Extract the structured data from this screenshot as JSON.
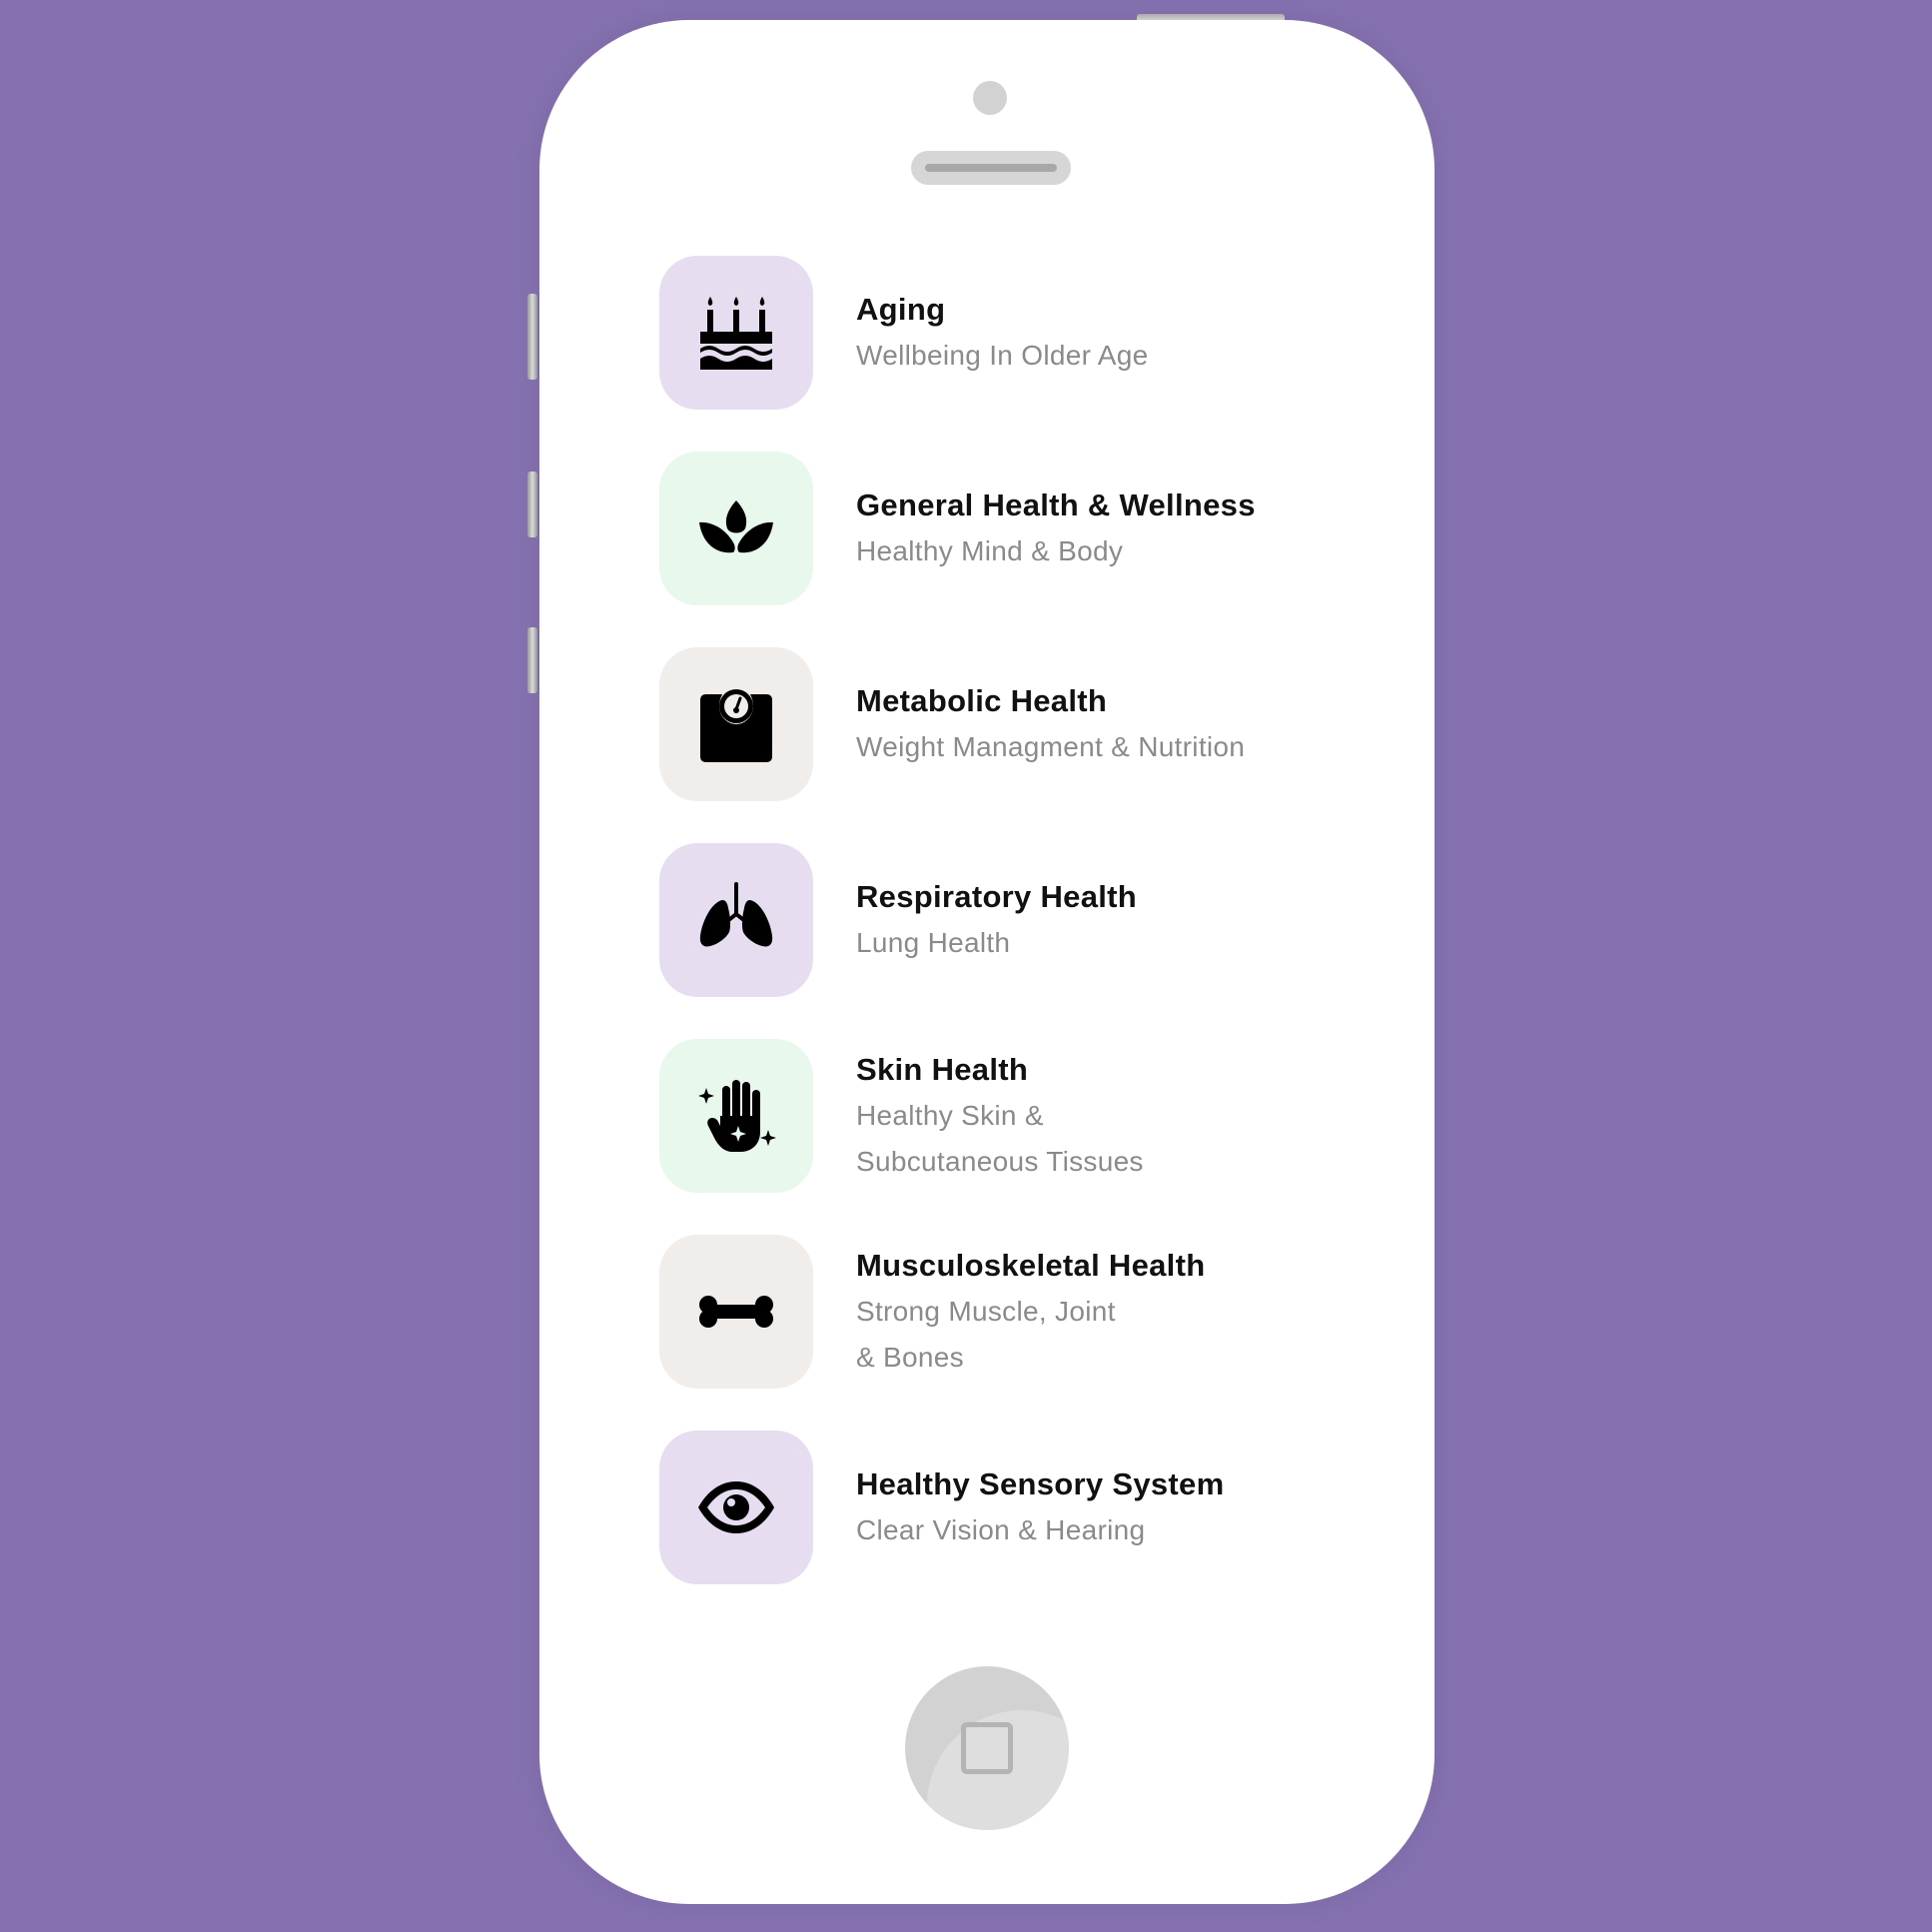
{
  "categories": [
    {
      "title": "Aging",
      "subtitle_lines": [
        "Wellbeing In Older Age"
      ],
      "icon": "cake-icon",
      "tile_color": "#e6ddf1"
    },
    {
      "title": "General Health & Wellness",
      "subtitle_lines": [
        "Healthy Mind & Body"
      ],
      "icon": "lotus-icon",
      "tile_color": "#e9f8ec"
    },
    {
      "title": "Metabolic Health",
      "subtitle_lines": [
        "Weight Managment & Nutrition"
      ],
      "icon": "weight-scale-icon",
      "tile_color": "#f0edeb"
    },
    {
      "title": "Respiratory Health",
      "subtitle_lines": [
        "Lung Health"
      ],
      "icon": "lungs-icon",
      "tile_color": "#e6ddf1"
    },
    {
      "title": "Skin Health",
      "subtitle_lines": [
        "Healthy Skin &",
        "Subcutaneous Tissues"
      ],
      "icon": "hand-sparkles-icon",
      "tile_color": "#e9f8ec"
    },
    {
      "title": "Musculoskeletal Health",
      "subtitle_lines": [
        "Strong Muscle, Joint",
        "& Bones"
      ],
      "icon": "bone-icon",
      "tile_color": "#f0edeb"
    },
    {
      "title": "Healthy Sensory System",
      "subtitle_lines": [
        "Clear Vision & Hearing"
      ],
      "icon": "eye-icon",
      "tile_color": "#e6ddf1"
    }
  ],
  "colors": {
    "background": "#8571b0",
    "phone": "#ffffff",
    "title_text": "#111111",
    "subtitle_text": "#8a8a8a"
  }
}
